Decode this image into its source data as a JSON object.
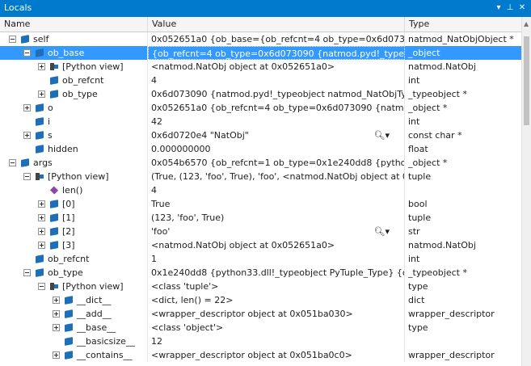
{
  "window": {
    "title": "Locals"
  },
  "columns": {
    "name": "Name",
    "value": "Value",
    "type": "Type"
  },
  "rows": [
    {
      "depth": 0,
      "exp": "minus",
      "icon": "cube",
      "name": "self",
      "value": "0x052651a0 {ob_base={ob_refcnt=4 ob_type=0x6d073090 {n",
      "type": "natmod_NatObjObject *"
    },
    {
      "depth": 1,
      "exp": "minus",
      "icon": "cube",
      "name": "ob_base",
      "value": "{ob_refcnt=4 ob_type=0x6d073090 {natmod.pyd!_typeobjec",
      "type": "_object",
      "selected": true
    },
    {
      "depth": 2,
      "exp": "plus",
      "icon": "pyview",
      "name": "[Python view]",
      "value": "<natmod.NatObj object at 0x052651a0>",
      "type": "natmod.NatObj"
    },
    {
      "depth": 2,
      "exp": "",
      "icon": "cube",
      "name": "ob_refcnt",
      "value": "4",
      "type": "int"
    },
    {
      "depth": 2,
      "exp": "plus",
      "icon": "cube",
      "name": "ob_type",
      "value": "0x6d073090 {natmod.pyd!_typeobject natmod_NatObjType}",
      "type": "_typeobject *"
    },
    {
      "depth": 1,
      "exp": "plus",
      "icon": "cube",
      "name": "o",
      "value": "0x052651a0 {ob_refcnt=4 ob_type=0x6d073090 {natmod.pyc",
      "type": "_object *"
    },
    {
      "depth": 1,
      "exp": "",
      "icon": "cube",
      "name": "i",
      "value": "42",
      "type": "int"
    },
    {
      "depth": 1,
      "exp": "plus",
      "icon": "cube",
      "name": "s",
      "value": "0x6d0720e4 \"NatObj\"",
      "type": "const char *",
      "mag": true
    },
    {
      "depth": 1,
      "exp": "",
      "icon": "cube",
      "name": "hidden",
      "value": "0.000000000",
      "type": "float"
    },
    {
      "depth": 0,
      "exp": "minus",
      "icon": "cube",
      "name": "args",
      "value": "0x054b6570 {ob_refcnt=1 ob_type=0x1e240dd8 {python33.d",
      "type": "_object *"
    },
    {
      "depth": 1,
      "exp": "minus",
      "icon": "pyview",
      "name": "[Python view]",
      "value": "(True, (123, 'foo', True), 'foo', <natmod.NatObj object at 0x0",
      "type": "tuple"
    },
    {
      "depth": 2,
      "exp": "",
      "icon": "method",
      "name": "len()",
      "value": "4",
      "type": ""
    },
    {
      "depth": 2,
      "exp": "plus",
      "icon": "cube",
      "name": "[0]",
      "value": "True",
      "type": "bool"
    },
    {
      "depth": 2,
      "exp": "plus",
      "icon": "cube",
      "name": "[1]",
      "value": "(123, 'foo', True)",
      "type": "tuple"
    },
    {
      "depth": 2,
      "exp": "plus",
      "icon": "cube",
      "name": "[2]",
      "value": "'foo'",
      "type": "str",
      "mag": true
    },
    {
      "depth": 2,
      "exp": "plus",
      "icon": "cube",
      "name": "[3]",
      "value": "<natmod.NatObj object at 0x052651a0>",
      "type": "natmod.NatObj"
    },
    {
      "depth": 1,
      "exp": "",
      "icon": "cube",
      "name": "ob_refcnt",
      "value": "1",
      "type": "int"
    },
    {
      "depth": 1,
      "exp": "minus",
      "icon": "cube",
      "name": "ob_type",
      "value": "0x1e240dd8 {python33.dll!_typeobject PyTuple_Type} {ob_b",
      "type": "_typeobject *"
    },
    {
      "depth": 2,
      "exp": "minus",
      "icon": "pyview",
      "name": "[Python view]",
      "value": "<class 'tuple'>",
      "type": "type"
    },
    {
      "depth": 3,
      "exp": "plus",
      "icon": "cube",
      "name": "__dict__",
      "value": "<dict, len() = 22>",
      "type": "dict"
    },
    {
      "depth": 3,
      "exp": "plus",
      "icon": "cube",
      "name": "__add__",
      "value": "<wrapper_descriptor object at 0x051ba030>",
      "type": "wrapper_descriptor"
    },
    {
      "depth": 3,
      "exp": "plus",
      "icon": "cube",
      "name": "__base__",
      "value": "<class 'object'>",
      "type": "type"
    },
    {
      "depth": 3,
      "exp": "",
      "icon": "cube",
      "name": "__basicsize__",
      "value": "12",
      "type": ""
    },
    {
      "depth": 3,
      "exp": "plus",
      "icon": "cube",
      "name": "__contains__",
      "value": "<wrapper_descriptor object at 0x051ba0c0>",
      "type": "wrapper_descriptor"
    }
  ]
}
